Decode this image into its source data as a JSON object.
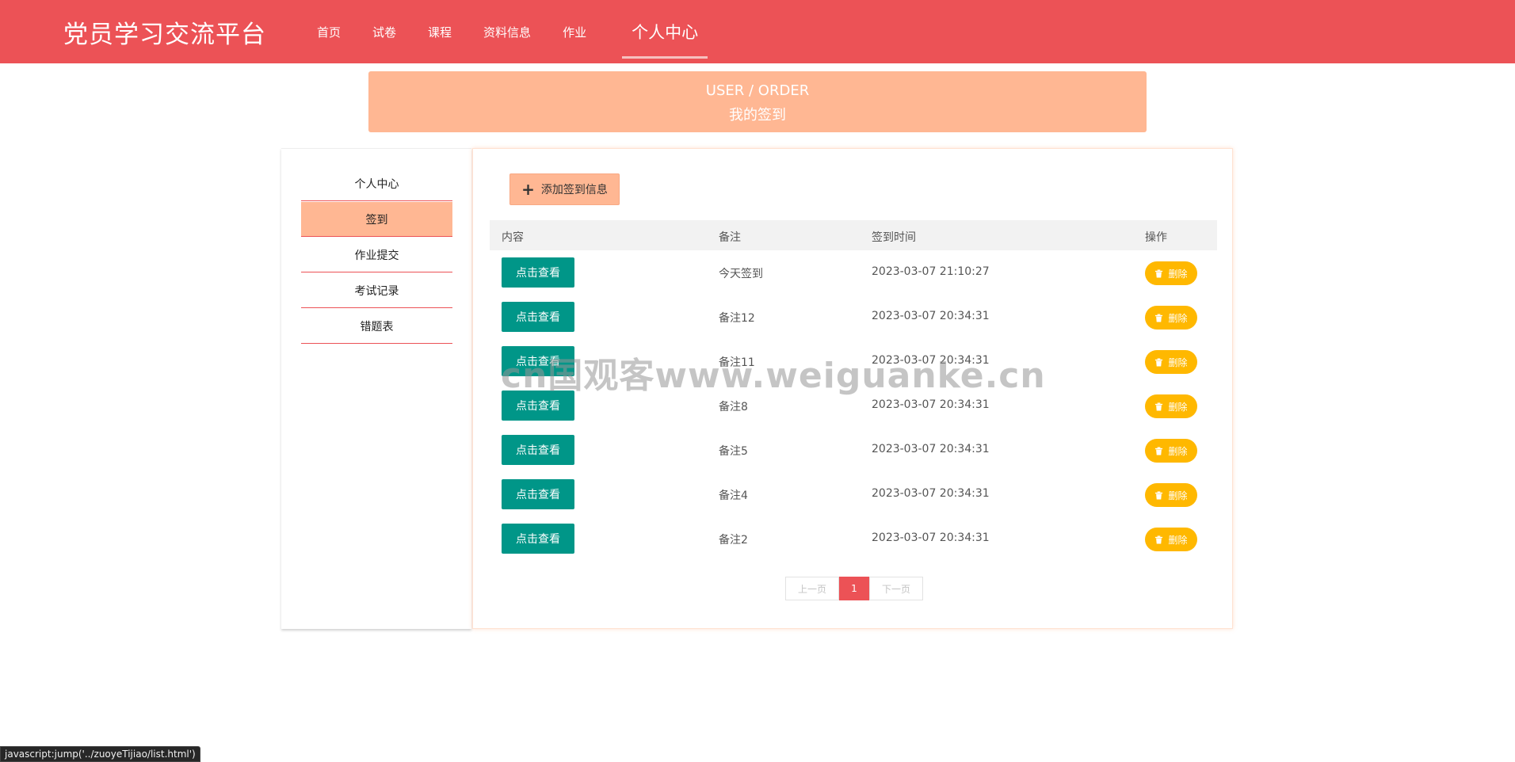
{
  "header": {
    "brand": "党员学习交流平台",
    "nav": [
      {
        "label": "首页"
      },
      {
        "label": "试卷"
      },
      {
        "label": "课程"
      },
      {
        "label": "资料信息"
      },
      {
        "label": "作业"
      },
      {
        "label": "个人中心",
        "active": true
      }
    ]
  },
  "banner": {
    "english": "USER / ORDER",
    "chinese": "我的签到"
  },
  "sidebar": {
    "items": [
      {
        "label": "个人中心"
      },
      {
        "label": "签到",
        "active": true
      },
      {
        "label": "作业提交"
      },
      {
        "label": "考试记录"
      },
      {
        "label": "错题表"
      }
    ]
  },
  "toolbar": {
    "add_label": "添加签到信息"
  },
  "table": {
    "headers": [
      "内容",
      "备注",
      "签到时间",
      "操作"
    ],
    "view_label": "点击查看",
    "delete_label": "删除",
    "rows": [
      {
        "note": "今天签到",
        "time": "2023-03-07 21:10:27"
      },
      {
        "note": "备注12",
        "time": "2023-03-07 20:34:31"
      },
      {
        "note": "备注11",
        "time": "2023-03-07 20:34:31"
      },
      {
        "note": "备注8",
        "time": "2023-03-07 20:34:31"
      },
      {
        "note": "备注5",
        "time": "2023-03-07 20:34:31"
      },
      {
        "note": "备注4",
        "time": "2023-03-07 20:34:31"
      },
      {
        "note": "备注2",
        "time": "2023-03-07 20:34:31"
      }
    ]
  },
  "pagination": {
    "prev": "上一页",
    "current": "1",
    "next": "下一页"
  },
  "watermark": "cn国观客www.weiguanke.cn",
  "statusbar": "javascript:jump('../zuoyeTijiao/list.html')",
  "colors": {
    "header": "#ec5256",
    "accent": "#ffb793",
    "view_button": "#009688",
    "delete_button": "#ffb800"
  }
}
